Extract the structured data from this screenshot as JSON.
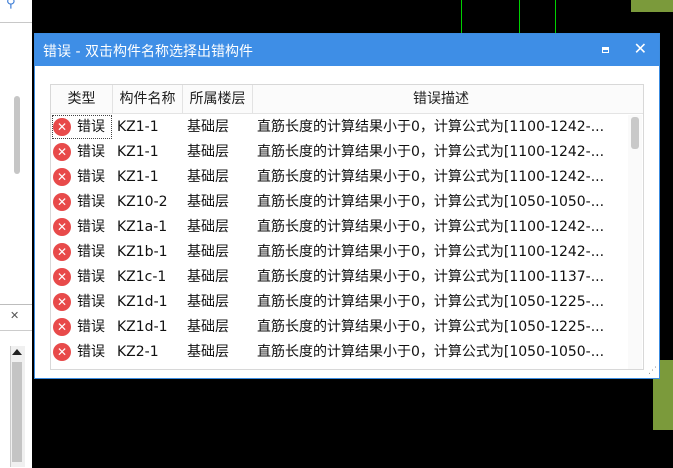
{
  "dialog": {
    "title": "错误 - 双击构件名称选择出错构件",
    "close_glyph": "✕"
  },
  "columns": [
    "类型",
    "构件名称",
    "所属楼层",
    "错误描述"
  ],
  "rows": [
    {
      "type": "错误",
      "name": "KZ1-1",
      "floor": "基础层",
      "desc": "直筋长度的计算结果小于0，计算公式为[1100-1242-..."
    },
    {
      "type": "错误",
      "name": "KZ1-1",
      "floor": "基础层",
      "desc": "直筋长度的计算结果小于0，计算公式为[1100-1242-..."
    },
    {
      "type": "错误",
      "name": "KZ1-1",
      "floor": "基础层",
      "desc": "直筋长度的计算结果小于0，计算公式为[1100-1242-..."
    },
    {
      "type": "错误",
      "name": "KZ10-2",
      "floor": "基础层",
      "desc": "直筋长度的计算结果小于0，计算公式为[1050-1050-..."
    },
    {
      "type": "错误",
      "name": "KZ1a-1",
      "floor": "基础层",
      "desc": "直筋长度的计算结果小于0，计算公式为[1100-1242-..."
    },
    {
      "type": "错误",
      "name": "KZ1b-1",
      "floor": "基础层",
      "desc": "直筋长度的计算结果小于0，计算公式为[1100-1242-..."
    },
    {
      "type": "错误",
      "name": "KZ1c-1",
      "floor": "基础层",
      "desc": "直筋长度的计算结果小于0，计算公式为[1100-1137-..."
    },
    {
      "type": "错误",
      "name": "KZ1d-1",
      "floor": "基础层",
      "desc": "直筋长度的计算结果小于0，计算公式为[1050-1225-..."
    },
    {
      "type": "错误",
      "name": "KZ1d-1",
      "floor": "基础层",
      "desc": "直筋长度的计算结果小于0，计算公式为[1050-1225-..."
    },
    {
      "type": "错误",
      "name": "KZ2-1",
      "floor": "基础层",
      "desc": "直筋长度的计算结果小于0，计算公式为[1050-1050-..."
    }
  ],
  "background": {
    "cad_text": "ꟸ"
  },
  "colors": {
    "titlebar": "#3e8ee6",
    "error_icon": "#e84a4a"
  }
}
